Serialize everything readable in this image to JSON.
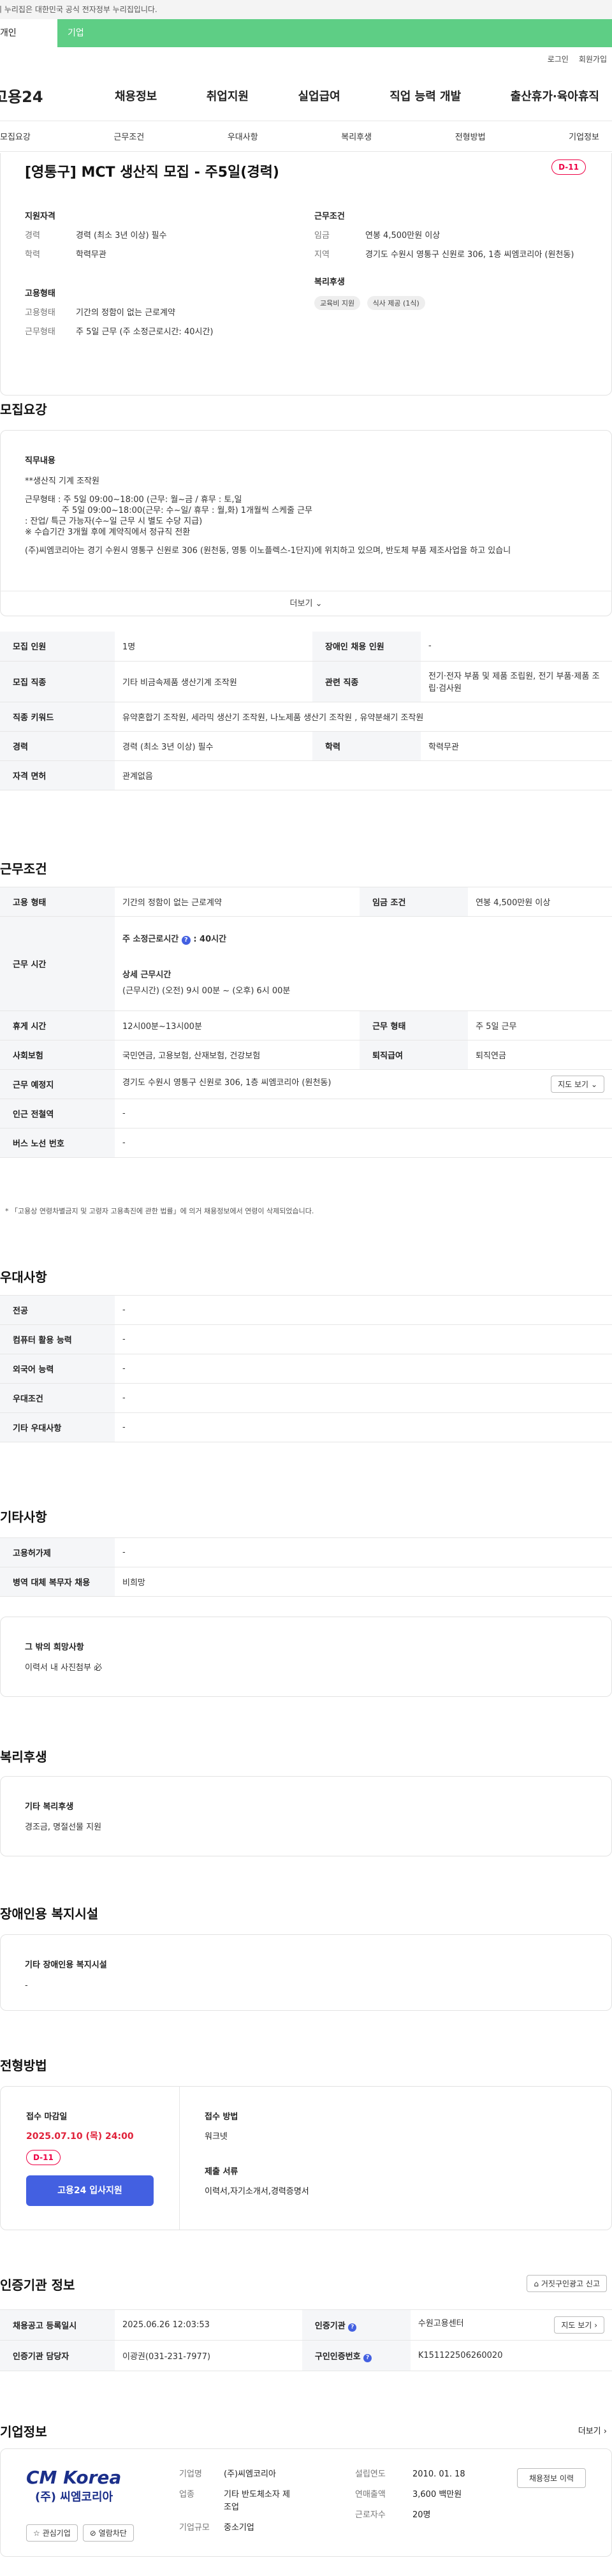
{
  "gov_banner": "이 누리집은 대한민국 공식 전자정부 누리집입니다.",
  "user_tabs": {
    "personal": "개인",
    "company": "기업"
  },
  "util": {
    "login": "로그인",
    "join": "회원가입"
  },
  "logo": "고용24",
  "gnb": [
    "채용정보",
    "취업지원",
    "실업급여",
    "직업 능력 개발",
    "출산휴가·육아휴직"
  ],
  "anchors": [
    "모집요강",
    "근무조건",
    "우대사항",
    "복리후생",
    "전형방법",
    "기업정보"
  ],
  "job": {
    "title": "[영통구] MCT 생산직 모집 - 주5일(경력)",
    "dday": "D-11",
    "summary": {
      "qual_title": "지원자격",
      "career_label": "경력",
      "career_value": "경력 (최소 3년 이상) 필수",
      "edu_label": "학력",
      "edu_value": "학력무관",
      "emp_title": "고용형태",
      "emp_type_label": "고용형태",
      "emp_type_value": "기간의 정함이 없는 근로계약",
      "work_type_label": "근무형태",
      "work_type_value": "주 5일 근무 (주 소정근로시간: 40시간)",
      "cond_title": "근무조건",
      "wage_label": "임금",
      "wage_value": "연봉 4,500만원 이상",
      "region_label": "지역",
      "region_value": "경기도 수원시 영통구 신원로 306, 1층 씨엠코리아 (원천동)",
      "welfare_title": "복리후생",
      "chips": [
        "교육비 지원",
        "식사 제공 (1식)"
      ]
    }
  },
  "recruit": {
    "section_title": "모집요강",
    "desc_title": "직무내용",
    "desc_lines": [
      "**생산직 기계 조작원",
      "",
      "근무형태 : 주 5일 09:00~18:00 (근무: 월~금 / 휴무 : 토,일",
      "              주 5일 09:00~18:00(근무: 수~일/ 휴무 : 월,화) 1개월씩 스케줄 근무",
      ": 잔업/ 특근 가능자(수~일 근무 시 별도 수당 지급)",
      "※ 수습기간 3개월 후에 계약직에서 정규직 전환",
      "",
      "(주)씨엠코리아는 경기 수원시 영통구 신원로 306 (원천동, 영통 이노플렉스-1단지)에 위치하고 있으며, 반도체 부품 제조사업을 하고 있습니"
    ],
    "more_label": "더보기",
    "rows": [
      {
        "k1": "모집 인원",
        "v1": "1명",
        "k2": "장애인 채용 인원",
        "v2": "-"
      },
      {
        "k1": "모집 직종",
        "v1": "기타 비금속제품 생산기계 조작원",
        "k2": "관련 직종",
        "v2": "전기·전자 부품 및 제품 조립원, 전기 부품·제품 조립·검사원"
      },
      {
        "k1": "직종 키워드",
        "v1": "유약혼합기 조작원, 세라믹 생산기 조작원, 나노제품 생산기 조작원 , 유약분쇄기 조작원",
        "k2": "",
        "v2": ""
      },
      {
        "k1": "경력",
        "v1": "경력 (최소 3년 이상) 필수",
        "k2": "학력",
        "v2": "학력무관"
      },
      {
        "k1": "자격 면허",
        "v1": "관계없음",
        "k2": "",
        "v2": ""
      }
    ]
  },
  "work": {
    "section_title": "근무조건",
    "emp_type_k": "고용 형태",
    "emp_type_v": "기간의 정함이 없는 근로계약",
    "wage_k": "임금 조건",
    "wage_v": "연봉 4,500만원 이상",
    "hours_k": "근무 시간",
    "hours_week_label": "주 소정근로시간",
    "hours_week_value": ": 40시간",
    "hours_detail_label": "상세 근무시간",
    "hours_detail_value": "(근무시간) (오전) 9시 00분 ~ (오후) 6시 00분",
    "break_k": "휴게 시간",
    "break_v": "12시00분~13시00분",
    "worktype_k": "근무 형태",
    "worktype_v": "주 5일 근무",
    "insurance_k": "사회보험",
    "insurance_v": "국민연금, 고용보험, 산재보험, 건강보험",
    "severance_k": "퇴직급여",
    "severance_v": "퇴직연금",
    "location_k": "근무 예정지",
    "location_v": "경기도 수원시 영통구 신원로 306, 1층 씨엠코리아 (원천동)",
    "map_btn": "지도 보기",
    "subway_k": "인근 전철역",
    "subway_v": "-",
    "bus_k": "버스 노선 번호",
    "bus_v": "-",
    "note": "「고용상 연령차별금지 및 고령자 고용촉진에 관한 법률」에 의거 채용정보에서 연령이 삭제되었습니다."
  },
  "preference": {
    "section_title": "우대사항",
    "rows": [
      {
        "k": "전공",
        "v": "-"
      },
      {
        "k": "컴퓨터 활용 능력",
        "v": "-"
      },
      {
        "k": "외국어 능력",
        "v": "-"
      },
      {
        "k": "우대조건",
        "v": "-"
      },
      {
        "k": "기타 우대사항",
        "v": "-"
      }
    ]
  },
  "etc": {
    "section_title": "기타사항",
    "rows": [
      {
        "k": "고용허가제",
        "v": "-"
      },
      {
        "k": "병역 대체 복무자 채용",
        "v": "비희망"
      }
    ],
    "wish_title": "그 밖의 희망사항",
    "wish_value": "이력서 내 사진첨부 必"
  },
  "welfare": {
    "section_title": "복리후생",
    "box_title": "기타 복리후생",
    "box_value": "경조금, 명절선물 지원"
  },
  "disabled": {
    "section_title": "장애인용 복지시설",
    "box_title": "기타 장애인용 복지시설",
    "box_value": "-"
  },
  "apply": {
    "section_title": "전형방법",
    "deadline_label": "접수 마감일",
    "deadline_value": "2025.07.10 (목) 24:00",
    "dday": "D-11",
    "apply_btn": "고용24 입사지원",
    "method_label": "접수 방법",
    "method_value": "워크넷",
    "docs_label": "제출 서류",
    "docs_value": "이력서,자기소개서,경력증명서"
  },
  "agency": {
    "section_title": "인증기관 정보",
    "report_btn": "거짓구인광고 신고",
    "reg_k": "채용공고 등록일시",
    "reg_v": "2025.06.26 12:03:53",
    "org_k": "인증기관",
    "org_v": "수원고용센터",
    "map_btn": "지도 보기",
    "mgr_k": "인증기관 담당자",
    "mgr_v": "이광권(031-231-7977)",
    "no_k": "구인인증번호",
    "no_v": "K151122506260020"
  },
  "company": {
    "section_title": "기업정보",
    "more_label": "더보기",
    "logo_main": "CM Korea",
    "logo_sub": "(주) 씨엠코리아",
    "fav_btn": "관심기업",
    "block_btn": "열람차단",
    "name_k": "기업명",
    "name_v": "(주)씨엠코리아",
    "industry_k": "업종",
    "industry_v": "기타 반도체소자 제조업",
    "size_k": "기업규모",
    "size_v": "중소기업",
    "founded_k": "설립연도",
    "founded_v": "2010. 01. 18",
    "sales_k": "연매출액",
    "sales_v": "3,600 백만원",
    "emp_k": "근로자수",
    "emp_v": "20명",
    "jobs_btn": "채용정보 이력"
  }
}
